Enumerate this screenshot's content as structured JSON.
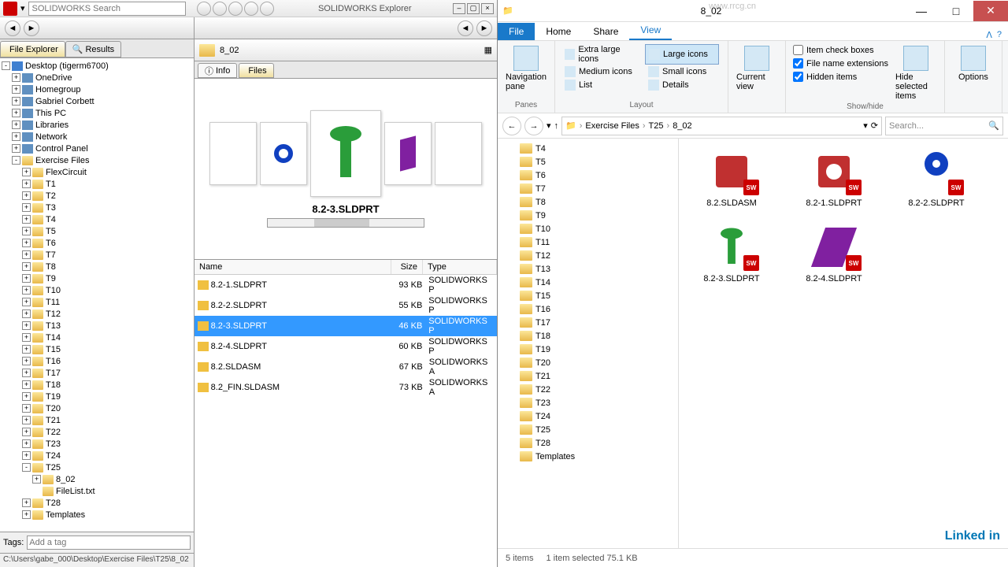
{
  "sw": {
    "search_placeholder": "SOLIDWORKS Search",
    "title": "SOLIDWORKS Explorer",
    "tabs": {
      "file_explorer": "File Explorer",
      "results": "Results"
    },
    "tree_root": "Desktop (tigerm6700)",
    "tree": [
      "OneDrive",
      "Homegroup",
      "Gabriel Corbett",
      "This PC",
      "Libraries",
      "Network",
      "Control Panel"
    ],
    "exercise": "Exercise Files",
    "ex_children_top": [
      "FlexCircuit",
      "T1",
      "T2",
      "T3",
      "T4",
      "T5",
      "T6",
      "T7",
      "T8",
      "T9",
      "T10",
      "T11",
      "T12",
      "T13",
      "T14",
      "T15",
      "T16",
      "T17",
      "T18",
      "T19",
      "T20",
      "T21",
      "T22",
      "T23",
      "T24"
    ],
    "t25": "T25",
    "t25_children": [
      "8_02",
      "FileList.txt"
    ],
    "ex_children_bot": [
      "T28",
      "Templates"
    ],
    "tags_label": "Tags:",
    "tags_placeholder": "Add a tag",
    "status": "C:\\Users\\gabe_000\\Desktop\\Exercise Files\\T25\\8_02",
    "path_folder": "8_02",
    "subtabs": {
      "info": "Info",
      "files": "Files"
    },
    "preview_name": "8.2-3.SLDPRT",
    "columns": {
      "name": "Name",
      "size": "Size",
      "type": "Type"
    },
    "files": [
      {
        "name": "8.2-1.SLDPRT",
        "size": "93 KB",
        "type": "SOLIDWORKS P"
      },
      {
        "name": "8.2-2.SLDPRT",
        "size": "55 KB",
        "type": "SOLIDWORKS P"
      },
      {
        "name": "8.2-3.SLDPRT",
        "size": "46 KB",
        "type": "SOLIDWORKS P"
      },
      {
        "name": "8.2-4.SLDPRT",
        "size": "60 KB",
        "type": "SOLIDWORKS P"
      },
      {
        "name": "8.2.SLDASM",
        "size": "67 KB",
        "type": "SOLIDWORKS A"
      },
      {
        "name": "8.2_FIN.SLDASM",
        "size": "73 KB",
        "type": "SOLIDWORKS A"
      }
    ],
    "selected_index": 2
  },
  "win": {
    "title": "8_02",
    "tabs": {
      "file": "File",
      "home": "Home",
      "share": "Share",
      "view": "View"
    },
    "ribbon": {
      "nav_pane": "Navigation pane",
      "panes": "Panes",
      "xl_icons": "Extra large icons",
      "lg_icons": "Large icons",
      "md_icons": "Medium icons",
      "sm_icons": "Small icons",
      "list": "List",
      "details": "Details",
      "layout": "Layout",
      "current_view": "Current view",
      "item_check": "Item check boxes",
      "file_ext": "File name extensions",
      "hidden": "Hidden items",
      "hide_sel": "Hide selected items",
      "showhide": "Show/hide",
      "options": "Options"
    },
    "breadcrumb": [
      "Exercise Files",
      "T25",
      "8_02"
    ],
    "search_placeholder": "Search...",
    "tree": [
      "T4",
      "T5",
      "T6",
      "T7",
      "T8",
      "T9",
      "T10",
      "T11",
      "T12",
      "T13",
      "T14",
      "T15",
      "T16",
      "T17",
      "T18",
      "T19",
      "T20",
      "T21",
      "T22",
      "T23",
      "T24",
      "T25",
      "T28",
      "Templates"
    ],
    "files": [
      "8.2.SLDASM",
      "8.2-1.SLDPRT",
      "8.2-2.SLDPRT",
      "8.2-3.SLDPRT",
      "8.2-4.SLDPRT"
    ],
    "status": {
      "count": "5 items",
      "sel": "1 item selected  75.1 KB"
    }
  },
  "watermark": "Linked in",
  "watermark2": "www.rrcg.cn"
}
